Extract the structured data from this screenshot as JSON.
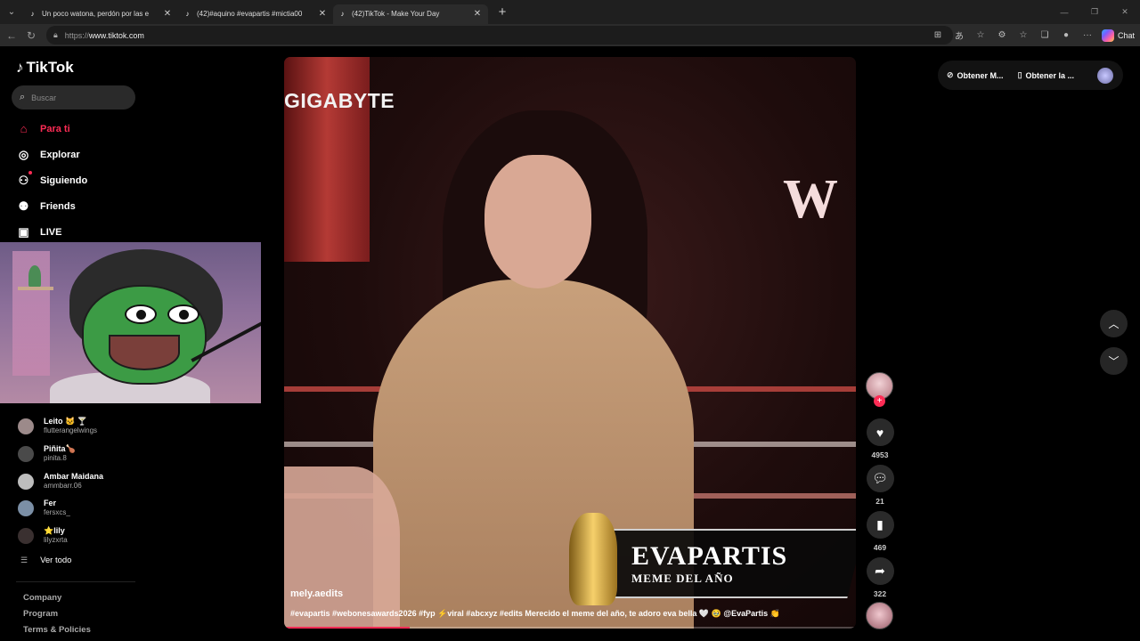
{
  "browser": {
    "tabs": [
      {
        "title": "Un poco watona, perdón por las e",
        "active": false
      },
      {
        "title": "(42)#aquino #evapartis #mictia00",
        "active": false
      },
      {
        "title": "(42)TikTok - Make Your Day",
        "active": true
      }
    ],
    "url_protocol": "https://",
    "url_host": "www.tiktok.com",
    "chat_label": "Chat"
  },
  "sidebar": {
    "logo": "TikTok",
    "search_placeholder": "Buscar",
    "menu": [
      {
        "label": "Para ti",
        "icon": "home-icon",
        "active": true
      },
      {
        "label": "Explorar",
        "icon": "compass-icon",
        "active": false
      },
      {
        "label": "Siguiendo",
        "icon": "following-icon",
        "active": false
      },
      {
        "label": "Friends",
        "icon": "friends-icon",
        "active": false
      },
      {
        "label": "LIVE",
        "icon": "live-icon",
        "active": false
      }
    ],
    "following": [
      {
        "name": "Leito 🐱 🍸",
        "handle": "flutterangelwings"
      },
      {
        "name": "Piñita🍗",
        "handle": "pinita.8"
      },
      {
        "name": "Ambar Maidana",
        "handle": "ammbarr.06"
      },
      {
        "name": "Fer",
        "handle": "fersxcs_"
      },
      {
        "name": "⭐lily",
        "handle": "lilyzxrta"
      }
    ],
    "see_all": "Ver todo",
    "footer": [
      "Company",
      "Program",
      "Terms & Policies"
    ]
  },
  "video": {
    "sign_text": "GIGABYTE",
    "award_title": "EVAPARTIS",
    "award_subtitle": "MEME DEL AÑO",
    "author": "mely.aedits",
    "caption": "#evapartis #webonesawards2026 #fyp ⚡viral #abcxyz #edits Merecido el meme del año, te adoro eva bella 🤍 🥹 @EvaPartis 👏",
    "progress": 0.22
  },
  "actions": {
    "likes": "4953",
    "comments": "21",
    "saves": "469",
    "shares": "322"
  },
  "topbar": {
    "coins": "Obtener M...",
    "app": "Obtener la ..."
  }
}
